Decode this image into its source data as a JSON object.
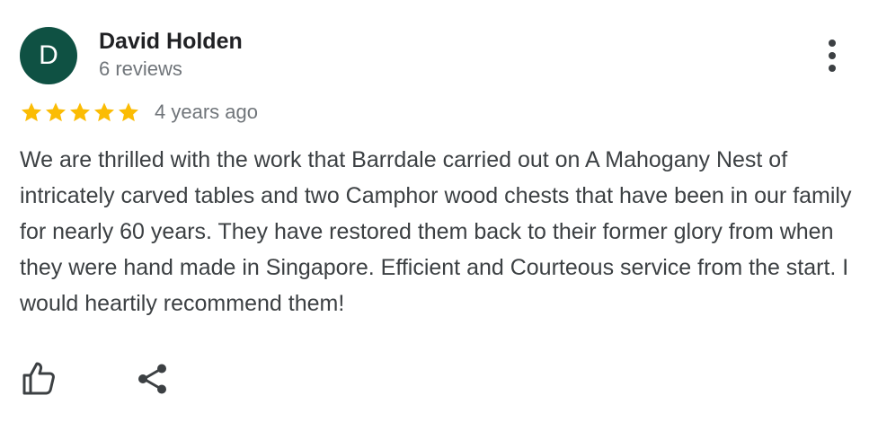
{
  "review": {
    "author": {
      "initial": "D",
      "name": "David Holden",
      "review_count": "6 reviews",
      "avatar_color": "#0f5143"
    },
    "rating": {
      "stars": 5,
      "max_stars": 5,
      "star_color": "#fbbc04"
    },
    "date": "4 years ago",
    "text": "We are thrilled with the work that Barrdale carried out on A Mahogany Nest of intricately carved tables and two Camphor wood chests that have been in our family for nearly 60 years. They have restored them back to their former glory from when they were hand made in Singapore. Efficient and Courteous service from the start. I would heartily recommend them!",
    "menu_icon": "more-vertical-icon",
    "actions": [
      {
        "icon": "thumb-up-icon"
      },
      {
        "icon": "share-icon"
      }
    ]
  }
}
